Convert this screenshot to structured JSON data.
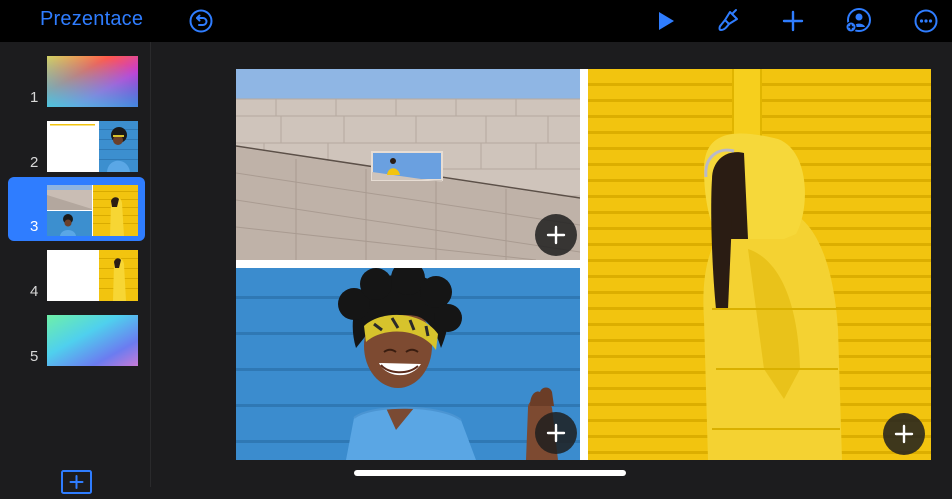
{
  "header": {
    "back_label": "Prezentace",
    "icons": [
      "undo-icon",
      "play-icon",
      "format-brush-icon",
      "add-icon",
      "collaborate-icon",
      "more-icon"
    ]
  },
  "sidebar": {
    "slides": [
      {
        "number": "1",
        "selected": false
      },
      {
        "number": "2",
        "selected": false
      },
      {
        "number": "3",
        "selected": true
      },
      {
        "number": "4",
        "selected": false
      },
      {
        "number": "5",
        "selected": false
      }
    ],
    "add_slide_icon": "add-slide-icon"
  },
  "colors": {
    "accent": "#2f7dff",
    "toolbar_bg": "#000000",
    "sidebar_bg": "#1c1c1e",
    "yellow": "#f2c40f",
    "blue": "#3c8fcf"
  }
}
